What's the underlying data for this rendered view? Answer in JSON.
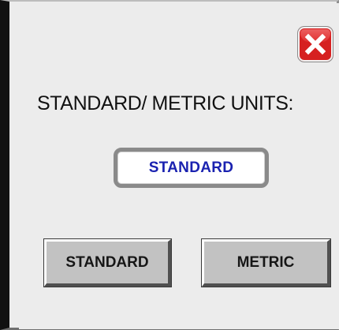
{
  "dialog": {
    "close_button": {
      "icon": "close-icon",
      "color": "#d62020"
    },
    "title": "STANDARD/ METRIC UNITS:",
    "current_value": "STANDARD",
    "current_value_color": "#1a22b0",
    "buttons": {
      "standard_label": "STANDARD",
      "metric_label": "METRIC"
    }
  }
}
